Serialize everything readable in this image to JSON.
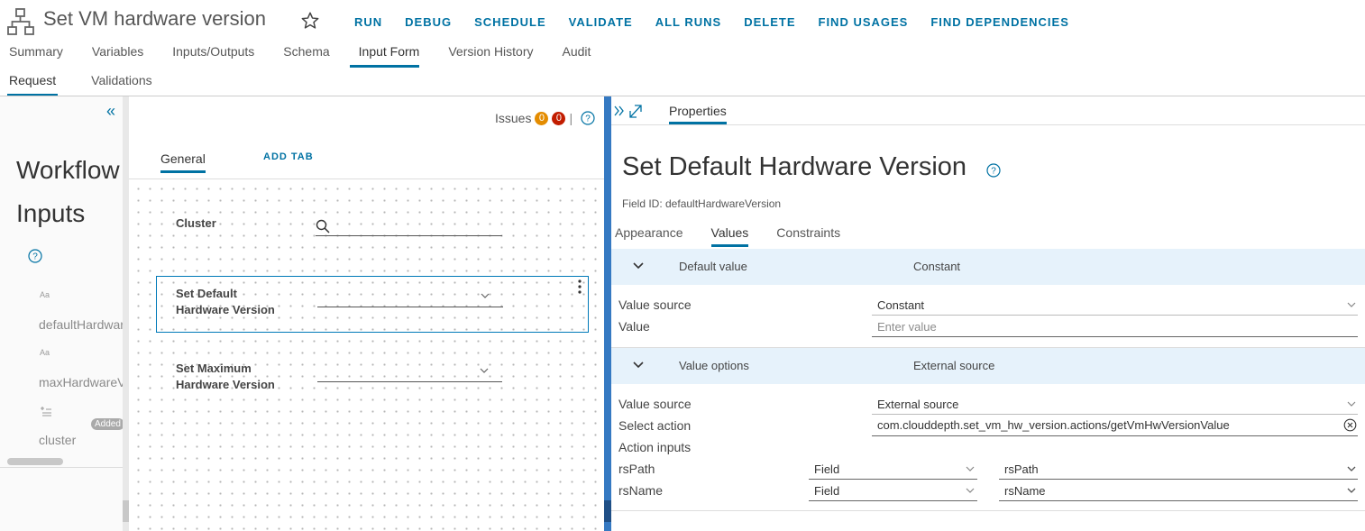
{
  "header": {
    "title": "Set VM hardware version",
    "actions": [
      "RUN",
      "DEBUG",
      "SCHEDULE",
      "VALIDATE",
      "ALL RUNS",
      "DELETE",
      "FIND USAGES",
      "FIND DEPENDENCIES"
    ]
  },
  "main_tabs": [
    "Summary",
    "Variables",
    "Inputs/Outputs",
    "Schema",
    "Input Form",
    "Version History",
    "Audit"
  ],
  "sub_tabs": [
    "Request",
    "Validations"
  ],
  "left_panel": {
    "title": "Workflow Inputs",
    "aa": "Aa",
    "items": [
      "defaultHardwareVersion",
      "maxHardwareVersion",
      "cluster"
    ],
    "added_badge": "Added"
  },
  "canvas": {
    "issues_label": "Issues",
    "warnings": "0",
    "errors": "0",
    "issues_sep": "|",
    "general_tab": "General",
    "add_tab": "ADD TAB",
    "fields": {
      "cluster": "Cluster",
      "default_hw_1": "Set Default",
      "default_hw_2": "Hardware Version",
      "max_hw_1": "Set Maximum",
      "max_hw_2": "Hardware Version"
    }
  },
  "properties": {
    "tab": "Properties",
    "title": "Set Default Hardware Version",
    "field_id": "Field ID: defaultHardwareVersion",
    "tabs": [
      "Appearance",
      "Values",
      "Constraints"
    ],
    "default_value": {
      "header": "Default value",
      "header_value": "Constant",
      "value_source_label": "Value source",
      "value_source": "Constant",
      "value_label": "Value",
      "value_placeholder": "Enter value"
    },
    "value_options": {
      "header": "Value options",
      "header_value": "External source",
      "value_source_label": "Value source",
      "value_source": "External source",
      "select_action_label": "Select action",
      "select_action": "com.clouddepth.set_vm_hw_version.actions/getVmHwVersionValue",
      "action_inputs_label": "Action inputs",
      "inputs": [
        {
          "name": "rsPath",
          "type": "Field",
          "value": "rsPath"
        },
        {
          "name": "rsName",
          "type": "Field",
          "value": "rsName"
        }
      ]
    }
  },
  "colors": {
    "accent": "#0072a3",
    "splitter": "#3579c2",
    "warning": "#e48c00",
    "error": "#c21d00",
    "section_bg": "#e6f2fb"
  }
}
